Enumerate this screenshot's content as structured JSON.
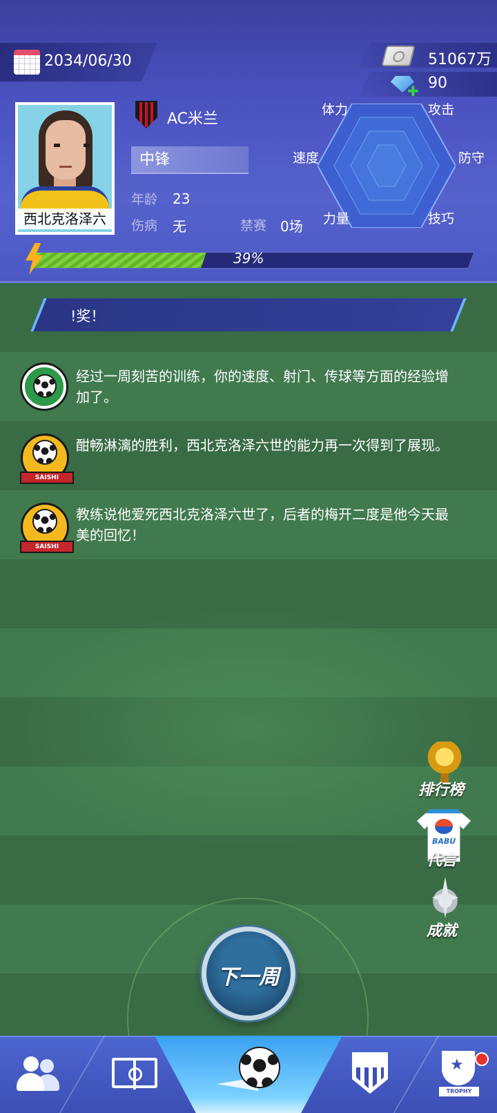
{
  "header": {
    "date": "2034/06/30",
    "cash": "51067万",
    "gems": "90"
  },
  "player": {
    "name": "西北克洛泽六",
    "club": "AC米兰",
    "position": "中锋",
    "age_label": "年龄",
    "age": "23",
    "injury_label": "伤病",
    "injury": "无",
    "suspension_label": "禁赛",
    "suspension": "0场",
    "progress_text": "39%",
    "progress_value": 0.39
  },
  "radar": {
    "stamina": "体力",
    "attack": "攻击",
    "speed": "速度",
    "defense": "防守",
    "strength": "力量",
    "skill": "技巧"
  },
  "banner": {
    "text": "!奖！"
  },
  "feed": [
    {
      "icon": "training-icon",
      "text": "经过一周刻苦的训练，你的速度、射门、传球等方面的经验增加了。"
    },
    {
      "icon": "match-icon",
      "badge": "SAISHI",
      "text": "酣畅淋漓的胜利，西北克洛泽六世的能力再一次得到了展现。"
    },
    {
      "icon": "match-icon",
      "badge": "SAISHI",
      "text": "教练说他爱死西北克洛泽六世了，后者的梅开二度是他今天最美的回忆！"
    }
  ],
  "side_buttons": {
    "leaderboard": "排行榜",
    "endorsement": "代言",
    "endorsement_brand": "BABU",
    "achievements": "成就"
  },
  "next_week_label": "下一周",
  "bottom_nav": {
    "items": [
      "team-icon",
      "pitch-icon",
      "match-ball-icon",
      "club-shield-icon",
      "trophy-icon"
    ],
    "trophy_text": "TROPHY"
  },
  "colors": {
    "header_bg": "#4a52c0",
    "field_green": "#3d7048",
    "progress_green": "#7fd23a",
    "nav_active": "#3aa0f2",
    "notification": "#e7332d"
  }
}
